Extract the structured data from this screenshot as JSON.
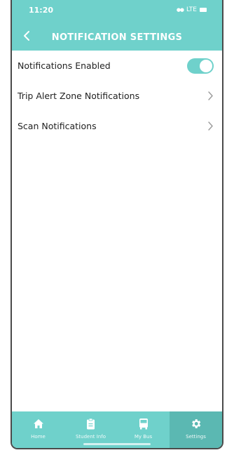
{
  "status_bar": {
    "time": "11:20",
    "network": "LTE"
  },
  "header": {
    "title": "NOTIFICATION SETTINGS",
    "back_icon": "chevron-left-icon"
  },
  "settings": {
    "items": [
      {
        "label": "Notifications Enabled",
        "control": "toggle",
        "enabled": true
      },
      {
        "label": "Trip Alert Zone Notifications",
        "control": "chevron"
      },
      {
        "label": "Scan Notifications",
        "control": "chevron"
      }
    ]
  },
  "tabbar": {
    "tabs": [
      {
        "label": "Home",
        "icon": "home-icon",
        "active": false
      },
      {
        "label": "Student Info",
        "icon": "clipboard-icon",
        "active": false
      },
      {
        "label": "My Bus",
        "icon": "bus-icon",
        "active": false
      },
      {
        "label": "Settings",
        "icon": "gear-icon",
        "active": true
      }
    ]
  },
  "colors": {
    "accent": "#6fd1cb",
    "active_tab": "#5bb8b2",
    "text": "#222222"
  }
}
